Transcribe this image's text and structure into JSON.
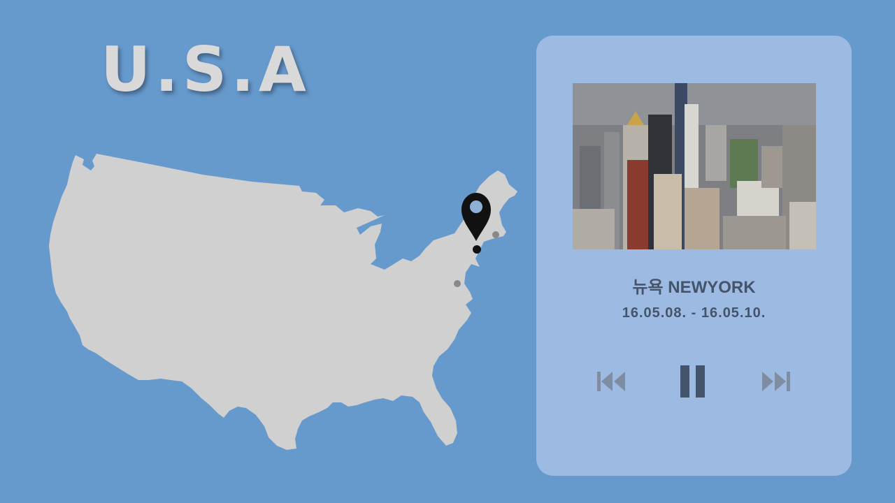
{
  "slide": {
    "title": "U.S.A"
  },
  "card": {
    "city": "뉴욕 NEWYORK",
    "dates": "16.05.08. - 16.05.10."
  },
  "controls": {
    "prev_icon": "skip-back-icon",
    "pause_icon": "pause-icon",
    "next_icon": "skip-forward-icon"
  },
  "colors": {
    "background": "#6699cc",
    "card": "#9dbbe2",
    "map": "#d0d0d0",
    "title": "#d9d9d9",
    "text": "#44546a",
    "pause": "#44546a",
    "skip": "#7f8da3",
    "pin": "#111111",
    "dot": "#888888"
  }
}
